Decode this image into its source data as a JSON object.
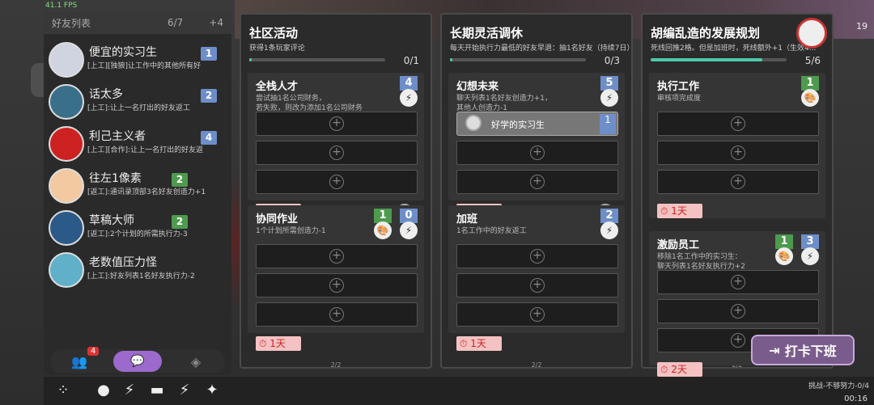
{
  "fps": "41.1 FPS",
  "top_right_num": "19",
  "sidebar": {
    "title": "好友列表",
    "count": "6/7",
    "plus": "+4",
    "friends": [
      {
        "name": "便宜的实习生",
        "lvl": "1",
        "lvl_color": "blue",
        "desc": "[上工][独狼]让工作中的其他所有好"
      },
      {
        "name": "话太多",
        "lvl": "2",
        "lvl_color": "blue",
        "desc": "[上工]:让上一名打出的好友返工"
      },
      {
        "name": "利己主义者",
        "lvl": "4",
        "lvl_color": "blue",
        "desc": "[上工][合作]:让上一名打出的好友返"
      },
      {
        "name": "往左1像素",
        "lvl": "2",
        "lvl_color": "green",
        "desc": "[返工]:通讯录顶部3名好友创造力+1"
      },
      {
        "name": "草稿大师",
        "lvl": "2",
        "lvl_color": "green",
        "desc": "[返工]:2个计划的所需执行力-3"
      },
      {
        "name": "老数值压力怪",
        "lvl": "",
        "lvl_color": "",
        "desc": "[上工]:好友列表1名好友执行力-2"
      }
    ],
    "tab_badge": "4"
  },
  "cards": [
    {
      "title": "社区活动",
      "sub": "获得1条玩家评论",
      "progress": "0/1",
      "fill": 0.02,
      "pager": "2/2",
      "tasks": [
        {
          "name": "全栈人才",
          "desc": "尝试抽1名公司财务，\n若失败，则改为添加1名公司财务",
          "req": [
            {
              "n": "4",
              "color": "blue",
              "icon": "⚡"
            }
          ],
          "timer": "2天"
        },
        {
          "name": "协同作业",
          "desc": "1个计划所需创造力-1",
          "req": [
            {
              "n": "1",
              "color": "green",
              "icon": "🎨"
            },
            {
              "n": "0",
              "color": "blue",
              "icon": "⚡"
            }
          ],
          "timer": "1天"
        }
      ]
    },
    {
      "title": "长期灵活调休",
      "sub": "每天开始执行力最低的好友早退：抽1名好友（持续7日）",
      "progress": "0/3",
      "fill": 0.02,
      "pager": "2/2",
      "tasks": [
        {
          "name": "幻想未来",
          "desc": "聊天列表1名好友创造力+1，\n其他人创造力-1",
          "req": [
            {
              "n": "5",
              "color": "blue",
              "icon": "⚡"
            }
          ],
          "timer": "2天",
          "filled": {
            "name": "好学的实习生",
            "lvl": "1"
          }
        },
        {
          "name": "加班",
          "desc": "1名工作中的好友返工",
          "req": [
            {
              "n": "2",
              "color": "blue",
              "icon": "⚡"
            }
          ],
          "timer": "1天"
        }
      ]
    },
    {
      "title": "胡编乱造的发展规划",
      "sub": "死线回推2格。但是加班时，死线额外+1（生效4...",
      "progress": "5/6",
      "fill": 0.82,
      "pager": "2/2",
      "tasks": [
        {
          "name": "执行工作",
          "desc": "审核项完成度",
          "req": [
            {
              "n": "1",
              "color": "green",
              "icon": "🎨"
            }
          ],
          "timer": "1天"
        },
        {
          "name": "激励员工",
          "desc": "移除1名工作中的实习生：\n聊天列表1名好友执行力+2",
          "req": [
            {
              "n": "1",
              "color": "green",
              "icon": "🎨"
            },
            {
              "n": "3",
              "color": "blue",
              "icon": "⚡"
            }
          ],
          "timer": "2天"
        }
      ]
    }
  ],
  "punch_button": "打卡下班",
  "status_line1": "挑战-不够努力-0/4",
  "clock": "00:16"
}
